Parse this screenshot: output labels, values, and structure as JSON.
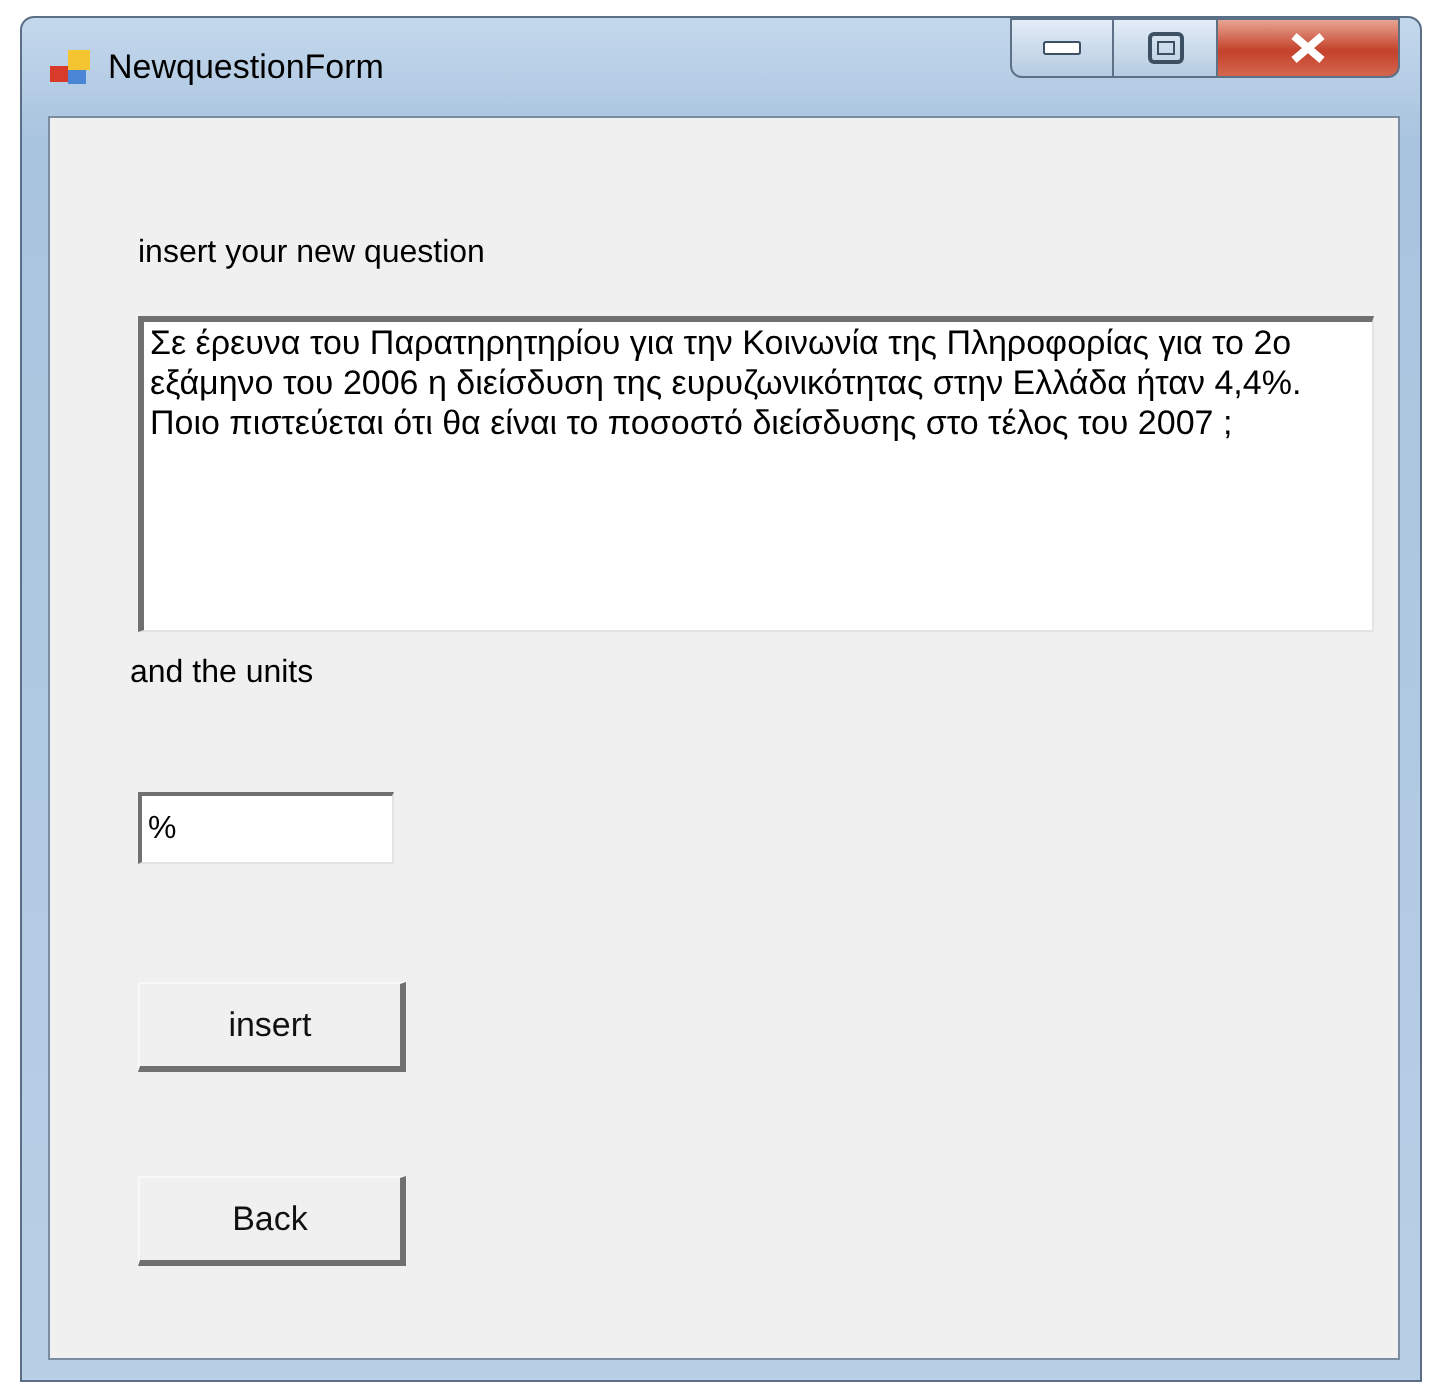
{
  "window": {
    "title": "NewquestionForm"
  },
  "question_label": "insert your new question",
  "question_field": {
    "value": "Σε έρευνα του Παρατηρητηρίου για την Κοινωνία της Πληροφορίας για το 2ο εξάμηνο του 2006 η διείσδυση της ευρυζωνικότητας στην Ελλάδα ήταν 4,4%. Ποιο πιστεύεται ότι θα είναι το ποσοστό διείσδυσης στο τέλος του 2007 ;"
  },
  "units_label": "and the units",
  "units_field": {
    "value": "%"
  },
  "buttons": [
    "insert",
    "Back"
  ]
}
